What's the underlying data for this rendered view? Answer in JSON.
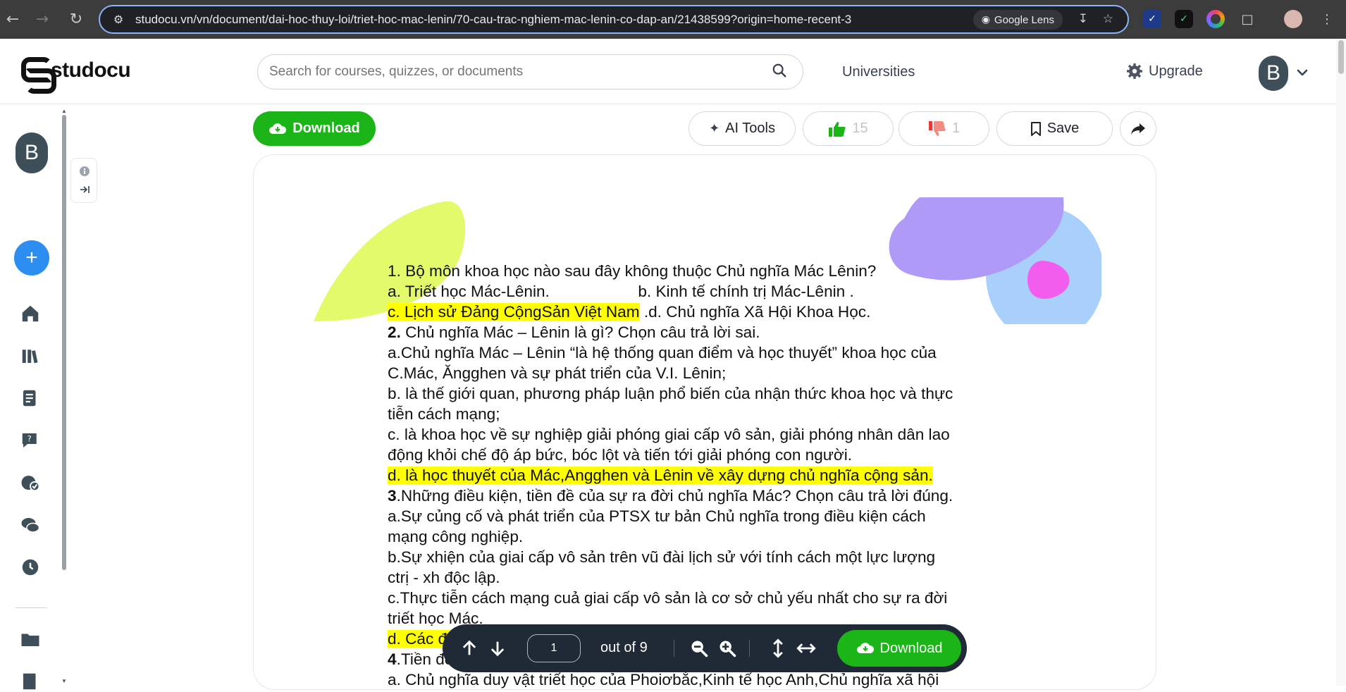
{
  "browser": {
    "url": "studocu.vn/vn/document/dai-hoc-thuy-loi/triet-hoc-mac-lenin/70-cau-trac-nghiem-mac-lenin-co-dap-an/21438599?origin=home-recent-3",
    "lens_label": "Google Lens"
  },
  "header": {
    "logo_text": "studocu",
    "search_placeholder": "Search for courses, quizzes, or documents",
    "universities": "Universities",
    "upgrade": "Upgrade",
    "avatar_letter": "B"
  },
  "sidebar": {
    "avatar_letter": "B",
    "add_symbol": "+"
  },
  "toolbar": {
    "download": "Download",
    "ai_tools": "AI Tools",
    "likes": "15",
    "dislikes": "1",
    "save": "Save"
  },
  "document": {
    "lines": [
      {
        "text": "1. Bộ môn khoa học nào sau đây không thuộc Chủ nghĩa Mác Lênin?",
        "parts": [
          {
            "t": "1. Bộ môn khoa học nào sau đây không thuộc Chủ nghĩa Mác Lênin?"
          }
        ]
      },
      {
        "parts": [
          {
            "t": "a. Triết học Mác-Lênin.                    b. Kinh tế chính trị Mác-Lênin ."
          }
        ]
      },
      {
        "parts": [
          {
            "t": "c. Lịch sử Đảng CộngSản Việt Nam",
            "hl": true
          },
          {
            "t": " .d. Chủ nghĩa Xã Hội Khoa Học."
          }
        ]
      },
      {
        "parts": [
          {
            "t": "2.",
            "b": true
          },
          {
            "t": " Chủ nghĩa Mác – Lênin là gì? Chọn câu trả lời sai."
          }
        ]
      },
      {
        "parts": [
          {
            "t": "a.Chủ nghĩa Mác – Lênin “là hệ thống quan điểm và học thuyết” khoa học của"
          }
        ]
      },
      {
        "parts": [
          {
            "t": "C.Mác, Ăngghen và sự phát triển của V.I. Lênin;"
          }
        ]
      },
      {
        "parts": [
          {
            "t": "b. là thế giới quan, phương pháp luận phổ biến của nhận thức khoa học và thực"
          }
        ]
      },
      {
        "parts": [
          {
            "t": "tiễn cách mạng;"
          }
        ]
      },
      {
        "parts": [
          {
            "t": "c. là khoa học về sự nghiệp giải phóng giai cấp vô sản, giải phóng nhân dân lao"
          }
        ]
      },
      {
        "parts": [
          {
            "t": "động khỏi chế độ áp bức, bóc lột và tiến tới giải phóng con người."
          }
        ]
      },
      {
        "parts": [
          {
            "t": "d. là học thuyết của Mác,Angghen và Lênin về xây dựng chủ nghĩa cộng sản.",
            "hl": true
          }
        ]
      },
      {
        "parts": [
          {
            "t": "3",
            "b": true
          },
          {
            "t": ".Những điều kiện, tiền đề của sự ra đời chủ nghĩa Mác? Chọn câu trả lời đúng."
          }
        ]
      },
      {
        "parts": [
          {
            "t": "a.Sự củng cố và phát triển của PTSX tư bản Chủ nghĩa trong điều kiện cách"
          }
        ]
      },
      {
        "parts": [
          {
            "t": "mạng công nghiệp."
          }
        ]
      },
      {
        "parts": [
          {
            "t": "b.Sự xhiện của giai cấp vô sản trên vũ đài lịch sử với tính cách một lực lượng"
          }
        ]
      },
      {
        "parts": [
          {
            "t": "ctrị - xh độc lập."
          }
        ]
      },
      {
        "parts": [
          {
            "t": "c.Thực tiễn cách mạng cuả giai cấp vô sản là cơ sở chủ yếu nhất cho sự ra đời"
          }
        ]
      },
      {
        "parts": [
          {
            "t": "triết học Mác."
          }
        ]
      },
      {
        "parts": [
          {
            "t": "d. Các đáp án trên đều đúng",
            "hl": true
          }
        ]
      },
      {
        "parts": [
          {
            "t": "4",
            "b": true
          },
          {
            "t": ".Tiền đề lý luận của chủ nghĩa Mác - Lênin?"
          }
        ]
      },
      {
        "parts": [
          {
            "t": "a. Chủ nghĩa duy vật triết học của Phoiơbắc,Kinh tế học Anh,Chủ nghĩa xã hội"
          }
        ]
      }
    ]
  },
  "viewer": {
    "page": "1",
    "out_of": "out of 9",
    "download": "Download"
  },
  "colors": {
    "brand_green": "#1bb517",
    "highlight": "#ffff00",
    "viewer_bar": "#1f2a36",
    "add_blue": "#2b8ef0"
  }
}
